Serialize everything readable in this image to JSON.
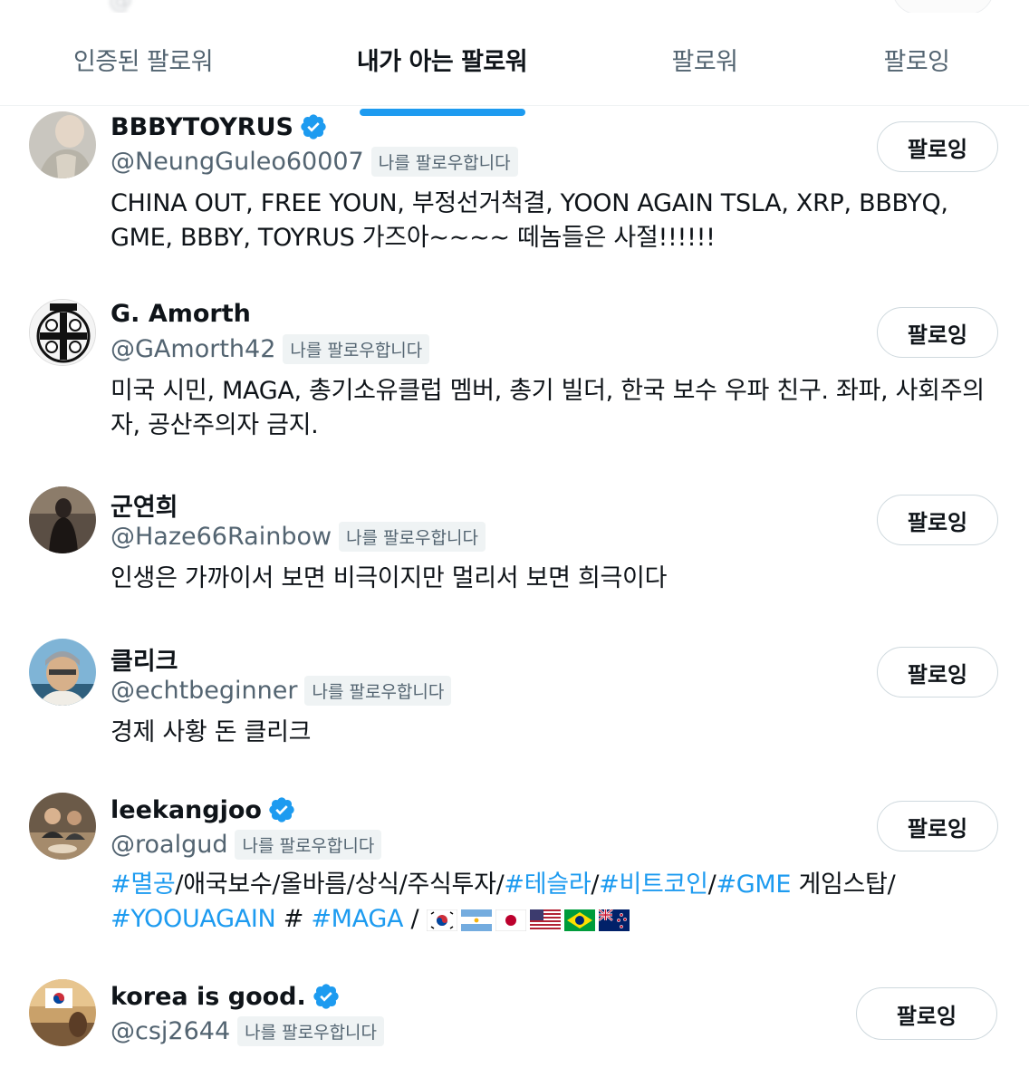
{
  "tabs": [
    {
      "label": "인증된 팔로워",
      "active": false
    },
    {
      "label": "내가 아는 팔로워",
      "active": true
    },
    {
      "label": "팔로워",
      "active": false
    },
    {
      "label": "팔로잉",
      "active": false
    }
  ],
  "colors": {
    "accent": "#1d9bf0",
    "secondary_text": "#536471",
    "verified": "#1d9bf0"
  },
  "follows_you_label": "나를 팔로우합니다",
  "users": [
    {
      "name": "BBBYTOYRUS",
      "verified": true,
      "handle": "@NeungGuleo60007",
      "follows_you": "나를 팔로우합니다",
      "button": "팔로잉",
      "bio": "CHINA OUT, FREE YOUN, 부정선거척결, YOON AGAIN TSLA, XRP, BBBYQ, GME, BBBY, TOYRUS 가즈아~~~~ 떼놈들은 사절!!!!!!"
    },
    {
      "name": "G. Amorth",
      "verified": false,
      "handle": "@GAmorth42",
      "follows_you": "나를 팔로우합니다",
      "button": "팔로잉",
      "bio": "미국 시민, MAGA, 총기소유클럽 멤버, 총기 빌더, 한국 보수 우파 친구. 좌파, 사회주의자, 공산주의자 금지."
    },
    {
      "name": "군연희",
      "verified": false,
      "handle": "@Haze66Rainbow",
      "follows_you": "나를 팔로우합니다",
      "button": "팔로잉",
      "bio": "인생은 가까이서 보면 비극이지만 멀리서 보면 희극이다"
    },
    {
      "name": "클리크",
      "verified": false,
      "handle": "@echtbeginner",
      "follows_you": "나를 팔로우합니다",
      "button": "팔로잉",
      "bio": "경제 사황 돈 클리크"
    },
    {
      "name": "leekangjoo",
      "verified": true,
      "handle": "@roalgud",
      "follows_you": "나를 팔로우합니다",
      "button": "팔로잉",
      "bio_parts": [
        {
          "text": "#멸공",
          "tag": true
        },
        {
          "text": "/애국보수/올바름/상식/주식투자/",
          "tag": false
        },
        {
          "text": "#테슬라",
          "tag": true
        },
        {
          "text": "/",
          "tag": false
        },
        {
          "text": "#비트코인",
          "tag": true
        },
        {
          "text": "/",
          "tag": false
        },
        {
          "text": "#GME",
          "tag": true
        },
        {
          "text": " 게임스탑/ ",
          "tag": false
        },
        {
          "text": "#YOOUAGAIN",
          "tag": true
        },
        {
          "text": " # ",
          "tag": false
        },
        {
          "text": "#MAGA",
          "tag": true
        },
        {
          "text": " / ",
          "tag": false
        }
      ],
      "flags": [
        "korea-flag",
        "argentina-flag",
        "japan-flag",
        "usa-flag",
        "brazil-flag",
        "new-zealand-flag"
      ]
    },
    {
      "name": "korea is good.",
      "verified": true,
      "handle": "@csj2644",
      "follows_you": "나를 팔로우합니다",
      "button": "팔로잉"
    }
  ]
}
